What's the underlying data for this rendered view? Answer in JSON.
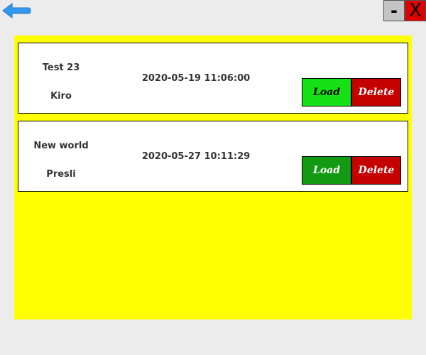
{
  "window": {
    "minimize_label": "-",
    "close_label": "X"
  },
  "icons": {
    "back": "back-arrow-icon"
  },
  "colors": {
    "list_background": "#ffff00",
    "load_button": "#16e016",
    "load_button_active": "#129a12",
    "delete_button": "#c40000",
    "back_arrow": "#3399ee"
  },
  "saves": [
    {
      "name": "Test 23",
      "author": "Kiro",
      "timestamp": "2020-05-19 11:06:00",
      "load_label": "Load",
      "delete_label": "Delete"
    },
    {
      "name": "New world",
      "author": "Presli",
      "timestamp": "2020-05-27 10:11:29",
      "load_label": "Load",
      "delete_label": "Delete"
    }
  ]
}
